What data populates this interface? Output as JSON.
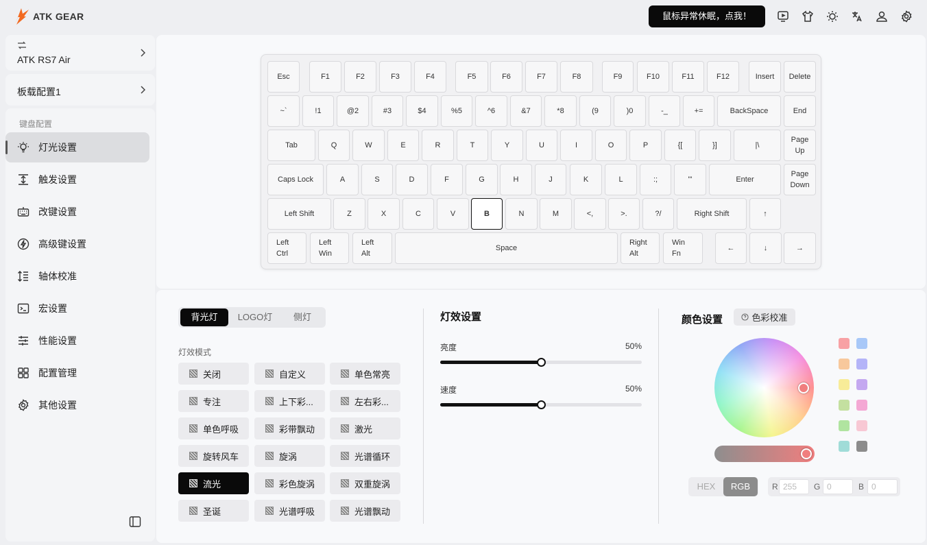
{
  "header": {
    "brand": "ATK GEAR",
    "alert": "鼠标异常休眠，点我！",
    "icons": [
      "monitor-icon",
      "shirt-icon",
      "sun-icon",
      "translate-icon",
      "user-icon",
      "settings-icon"
    ]
  },
  "sidebar": {
    "device_name": "ATK RS7 Air",
    "profile_name": "板载配置1",
    "section_label": "键盘配置",
    "items": [
      {
        "label": "灯光设置",
        "icon": "bulb-icon"
      },
      {
        "label": "触发设置",
        "icon": "trigger-icon"
      },
      {
        "label": "改键设置",
        "icon": "keyboard-icon"
      },
      {
        "label": "高级键设置",
        "icon": "bolt-icon"
      },
      {
        "label": "轴体校准",
        "icon": "calibrate-icon"
      },
      {
        "label": "宏设置",
        "icon": "terminal-icon"
      },
      {
        "label": "性能设置",
        "icon": "sliders-icon"
      },
      {
        "label": "配置管理",
        "icon": "grid-icon"
      },
      {
        "label": "其他设置",
        "icon": "gear-icon"
      }
    ]
  },
  "keyboard": {
    "selected_key": "B",
    "rows": [
      [
        "Esc",
        "F1",
        "F2",
        "F3",
        "F4",
        "F5",
        "F6",
        "F7",
        "F8",
        "F9",
        "F10",
        "F11",
        "F12",
        "Insert",
        "Delete"
      ],
      [
        "~`",
        "!1",
        "@2",
        "#3",
        "$4",
        "%5",
        "^6",
        "&7",
        "*8",
        "(9",
        ")0",
        "-_",
        "+=",
        "BackSpace",
        "End"
      ],
      [
        "Tab",
        "Q",
        "W",
        "E",
        "R",
        "T",
        "Y",
        "U",
        "I",
        "O",
        "P",
        "{[",
        "}]",
        "|\\",
        "Page Up"
      ],
      [
        "Caps Lock",
        "A",
        "S",
        "D",
        "F",
        "G",
        "H",
        "J",
        "K",
        "L",
        ":;",
        "\"'",
        "Enter",
        "Page Down"
      ],
      [
        "Left Shift",
        "Z",
        "X",
        "C",
        "V",
        "B",
        "N",
        "M",
        "<,",
        ">.",
        "?/",
        "Right Shift",
        "↑"
      ],
      [
        "Left Ctrl",
        "Left Win",
        "Left Alt",
        "Space",
        "Right Alt",
        "Win Fn",
        "←",
        "↓",
        "→"
      ]
    ]
  },
  "lighting": {
    "tabs": [
      "背光灯",
      "LOGO灯",
      "侧灯"
    ],
    "mode_label": "灯效模式",
    "modes": [
      "关闭",
      "自定义",
      "单色常亮",
      "专注",
      "上下彩...",
      "左右彩...",
      "单色呼吸",
      "彩带飘动",
      "激光",
      "旋转风车",
      "旋涡",
      "光谱循环",
      "流光",
      "彩色旋涡",
      "双重旋涡",
      "圣诞",
      "光谱呼吸",
      "光谱飘动"
    ],
    "active_mode": "流光",
    "effect_title": "灯效设置",
    "brightness_label": "亮度",
    "brightness_value": "50%",
    "brightness": 0.5,
    "speed_label": "速度",
    "speed_value": "50%",
    "speed": 0.5
  },
  "color": {
    "title": "颜色设置",
    "calibrate_label": "色彩校准",
    "swatches": [
      "#f8a1a4",
      "#a8c8f8",
      "#f8c89c",
      "#b4b4f8",
      "#f8ec98",
      "#c4a8f0",
      "#c4e0a0",
      "#f4a8d4",
      "#b0e4a0",
      "#f8c8d4",
      "#a0dcd8",
      "#8c8c8c"
    ],
    "formats": [
      "HEX",
      "RGB"
    ],
    "active_format": "RGB",
    "r_label": "R",
    "r_value": "255",
    "g_label": "G",
    "g_value": "0",
    "b_label": "B",
    "b_value": "0"
  }
}
